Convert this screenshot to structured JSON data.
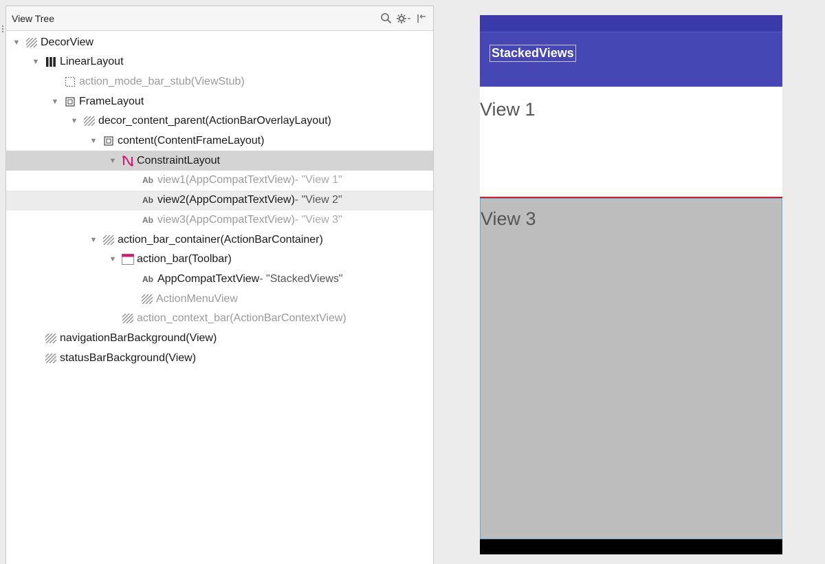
{
  "panel": {
    "title": "View Tree",
    "icons": [
      "search-icon",
      "gear-icon",
      "collapse-icon"
    ]
  },
  "tree": [
    {
      "indent": 0,
      "toggle": "▼",
      "icon": "hatched",
      "id": "DecorView",
      "type": "",
      "text": "",
      "state": "normal"
    },
    {
      "indent": 1,
      "toggle": "▼",
      "icon": "linear",
      "id": "LinearLayout",
      "type": "",
      "text": "",
      "state": "normal"
    },
    {
      "indent": 2,
      "toggle": "",
      "icon": "stub",
      "id": "action_mode_bar_stub",
      "type": " (ViewStub)",
      "text": "",
      "state": "dim"
    },
    {
      "indent": 2,
      "toggle": "▼",
      "icon": "frame",
      "id": "FrameLayout",
      "type": "",
      "text": "",
      "state": "normal"
    },
    {
      "indent": 3,
      "toggle": "▼",
      "icon": "hatched",
      "id": "decor_content_parent",
      "type": " (ActionBarOverlayLayout)",
      "text": "",
      "state": "normal"
    },
    {
      "indent": 4,
      "toggle": "▼",
      "icon": "frame",
      "id": "content",
      "type": " (ContentFrameLayout)",
      "text": "",
      "state": "normal"
    },
    {
      "indent": 5,
      "toggle": "▼",
      "icon": "constraint",
      "id": "ConstraintLayout",
      "type": "",
      "text": "",
      "state": "selected"
    },
    {
      "indent": 6,
      "toggle": "",
      "icon": "ab",
      "id": "view1",
      "type": " (AppCompatTextView)",
      "text": " - \"View 1\"",
      "state": "dim"
    },
    {
      "indent": 6,
      "toggle": "",
      "icon": "ab",
      "id": "view2",
      "type": " (AppCompatTextView)",
      "text": " - \"View 2\"",
      "state": "hover"
    },
    {
      "indent": 6,
      "toggle": "",
      "icon": "ab",
      "id": "view3",
      "type": " (AppCompatTextView)",
      "text": " - \"View 3\"",
      "state": "dim"
    },
    {
      "indent": 4,
      "toggle": "▼",
      "icon": "hatched",
      "id": "action_bar_container",
      "type": " (ActionBarContainer)",
      "text": "",
      "state": "normal"
    },
    {
      "indent": 5,
      "toggle": "▼",
      "icon": "toolbar",
      "id": "action_bar",
      "type": " (Toolbar)",
      "text": "",
      "state": "normal"
    },
    {
      "indent": 6,
      "toggle": "",
      "icon": "ab",
      "id": "AppCompatTextView",
      "type": "",
      "text": " - \"StackedViews\"",
      "state": "normal"
    },
    {
      "indent": 6,
      "toggle": "",
      "icon": "hatched",
      "id": "ActionMenuView",
      "type": "",
      "text": "",
      "state": "dim"
    },
    {
      "indent": 5,
      "toggle": "",
      "icon": "hatched",
      "id": "action_context_bar",
      "type": " (ActionBarContextView)",
      "text": "",
      "state": "dim"
    },
    {
      "indent": 1,
      "toggle": "",
      "icon": "hatched",
      "id": "navigationBarBackground",
      "type": " (View)",
      "text": "",
      "state": "normal"
    },
    {
      "indent": 1,
      "toggle": "",
      "icon": "hatched",
      "id": "statusBarBackground",
      "type": " (View)",
      "text": "",
      "state": "normal"
    }
  ],
  "device": {
    "toolbar_title": "StackedViews",
    "view1_text": "View 1",
    "view3_text": "View 3",
    "colors": {
      "status_bar": "#3a3aa8",
      "toolbar": "#4646b4",
      "selection_border": "#d0202c",
      "view3_bg": "#bdbdbd"
    }
  }
}
